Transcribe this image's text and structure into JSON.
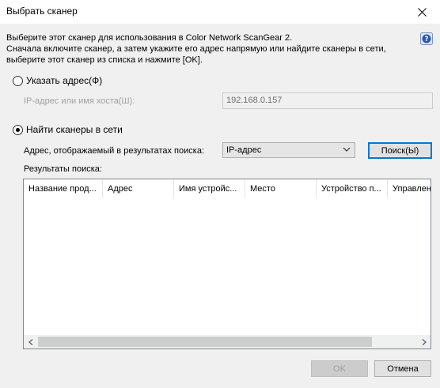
{
  "window": {
    "title": "Выбрать сканер"
  },
  "intro": {
    "line1": "Выберите этот сканер для использования в Color Network ScanGear 2.",
    "line2": "Сначала включите сканер, а затем укажите его адрес напрямую или найдите сканеры в сети,",
    "line3": "выберите этот сканер из списка и нажмите [OK]."
  },
  "specify_address": {
    "label": "Указать адрес(Ф)",
    "checked": false,
    "field_label": "IP-адрес или имя хоста(Ш):",
    "field_value": "192.168.0.157"
  },
  "find_scanners": {
    "label": "Найти сканеры в сети",
    "checked": true,
    "address_label": "Адрес, отображаемый в результатах поиска:",
    "address_value": "IP-адрес",
    "search_button": "Поиск(Ы)"
  },
  "results": {
    "label": "Результаты поиска:",
    "columns": [
      "Название прод...",
      "Адрес",
      "Имя устройс...",
      "Место",
      "Устройство п...",
      "Управлен"
    ],
    "rows": []
  },
  "footer": {
    "ok_button": "OK",
    "cancel_button": "Отмена"
  },
  "colors": {
    "dialog_bg": "#f0f0f0",
    "accent": "#0078d7"
  }
}
